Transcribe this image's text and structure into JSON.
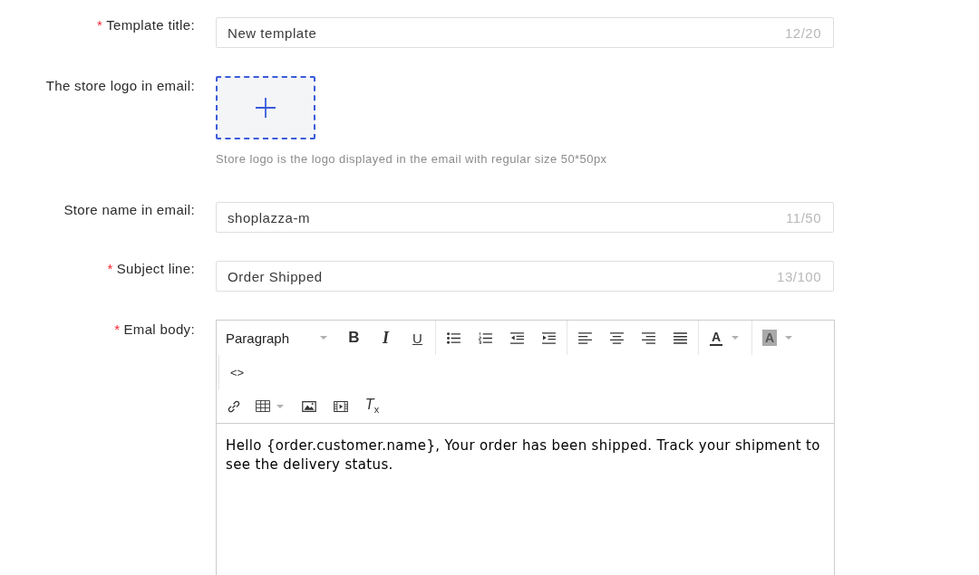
{
  "form": {
    "fields": [
      {
        "kind": "text",
        "required_mark": "*",
        "label": "Template title:",
        "value": "New template",
        "counter": "12/20"
      },
      {
        "kind": "upload",
        "label": "The store logo in email:",
        "hint": "Store logo is the logo displayed in the email with regular size 50*50px"
      },
      {
        "kind": "text",
        "label": "Store name in email:",
        "value": "shoplazza-m",
        "counter": "11/50"
      },
      {
        "kind": "text",
        "required_mark": "*",
        "label": "Subject line:",
        "value": "Order Shipped",
        "counter": "13/100"
      },
      {
        "kind": "editor",
        "required_mark": "*",
        "label": "Emal body:",
        "toolbar": {
          "block_format": "Paragraph",
          "bold": "B",
          "italic": "I",
          "underline": "U",
          "text_color": "A",
          "highlight_color": "A",
          "source_code": "<>",
          "clear_formatting": "*T*$_{x}$"
        },
        "content": "Hello {order.customer.name}, Your order has been shipped. Track your shipment to see the delivery status."
      }
    ]
  }
}
